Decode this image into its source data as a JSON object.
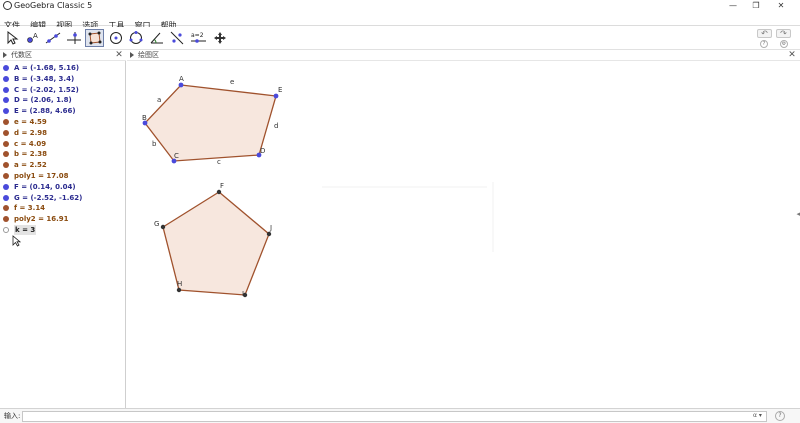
{
  "window": {
    "title": "GeoGebra Classic 5",
    "minimize_glyph": "—",
    "maximize_glyph": "❐",
    "close_glyph": "✕"
  },
  "menu": [
    "文件",
    "编辑",
    "视图",
    "选项",
    "工具",
    "窗口",
    "帮助"
  ],
  "toolbar": {
    "tools": [
      {
        "icon": "move-arrow-icon"
      },
      {
        "icon": "point-icon"
      },
      {
        "icon": "line-icon"
      },
      {
        "icon": "perpendicular-line-icon"
      },
      {
        "icon": "polygon-icon",
        "selected": true
      },
      {
        "icon": "circle-icon"
      },
      {
        "icon": "circle-three-points-icon"
      },
      {
        "icon": "angle-icon"
      },
      {
        "icon": "reflect-icon"
      },
      {
        "icon": "slider-icon",
        "label": "a=2"
      },
      {
        "icon": "move-view-icon"
      }
    ],
    "undo_glyph": "↶",
    "redo_glyph": "↷",
    "help_glyph": "?",
    "settings_glyph": "⚙"
  },
  "algebra": {
    "title": "代数区",
    "close_glyph": "✕",
    "items": [
      {
        "text": "A = (-1.68, 5.16)",
        "kind": "point",
        "visible": true
      },
      {
        "text": "B = (-3.48, 3.4)",
        "kind": "point",
        "visible": true
      },
      {
        "text": "C = (-2.02, 1.52)",
        "kind": "point",
        "visible": true
      },
      {
        "text": "D = (2.06, 1.8)",
        "kind": "point",
        "visible": true
      },
      {
        "text": "E = (2.88, 4.66)",
        "kind": "point",
        "visible": true
      },
      {
        "text": "e = 4.59",
        "kind": "segment",
        "visible": true
      },
      {
        "text": "d = 2.98",
        "kind": "segment",
        "visible": true
      },
      {
        "text": "c = 4.09",
        "kind": "segment",
        "visible": true
      },
      {
        "text": "b = 2.38",
        "kind": "segment",
        "visible": true
      },
      {
        "text": "a = 2.52",
        "kind": "segment",
        "visible": true
      },
      {
        "text": "poly1 = 17.08",
        "kind": "polygon",
        "visible": true
      },
      {
        "text": "F = (0.14, 0.04)",
        "kind": "point",
        "visible": true
      },
      {
        "text": "G = (-2.52, -1.62)",
        "kind": "point",
        "visible": true
      },
      {
        "text": "f = 3.14",
        "kind": "segment",
        "visible": true
      },
      {
        "text": "poly2 = 16.91",
        "kind": "polygon",
        "visible": true
      },
      {
        "text": "k = 3",
        "kind": "number",
        "visible": false
      }
    ]
  },
  "graphics": {
    "title": "绘图区",
    "close_glyph": "✕",
    "polygon1": {
      "vertices": [
        {
          "name": "A"
        },
        {
          "name": "E"
        },
        {
          "name": "D"
        },
        {
          "name": "C"
        },
        {
          "name": "B"
        }
      ],
      "segment_labels": [
        "e",
        "d",
        "c",
        "b",
        "a"
      ]
    },
    "polygon2": {
      "vertices": [
        {
          "name": "F"
        },
        {
          "name": "J"
        },
        {
          "name": "I"
        },
        {
          "name": "H"
        },
        {
          "name": "G"
        }
      ]
    }
  },
  "input": {
    "label": "输入:",
    "value": "",
    "symbol_glyph": "α ▾",
    "help_glyph": "?"
  },
  "colors": {
    "point": "#4a4adb",
    "point_text": "#2b2b8f",
    "measure_text": "#8a4b0f",
    "polygon_stroke": "#a0522d",
    "polygon_fill": "#f6e3d8",
    "selected_tool": "#dfe4ee"
  }
}
